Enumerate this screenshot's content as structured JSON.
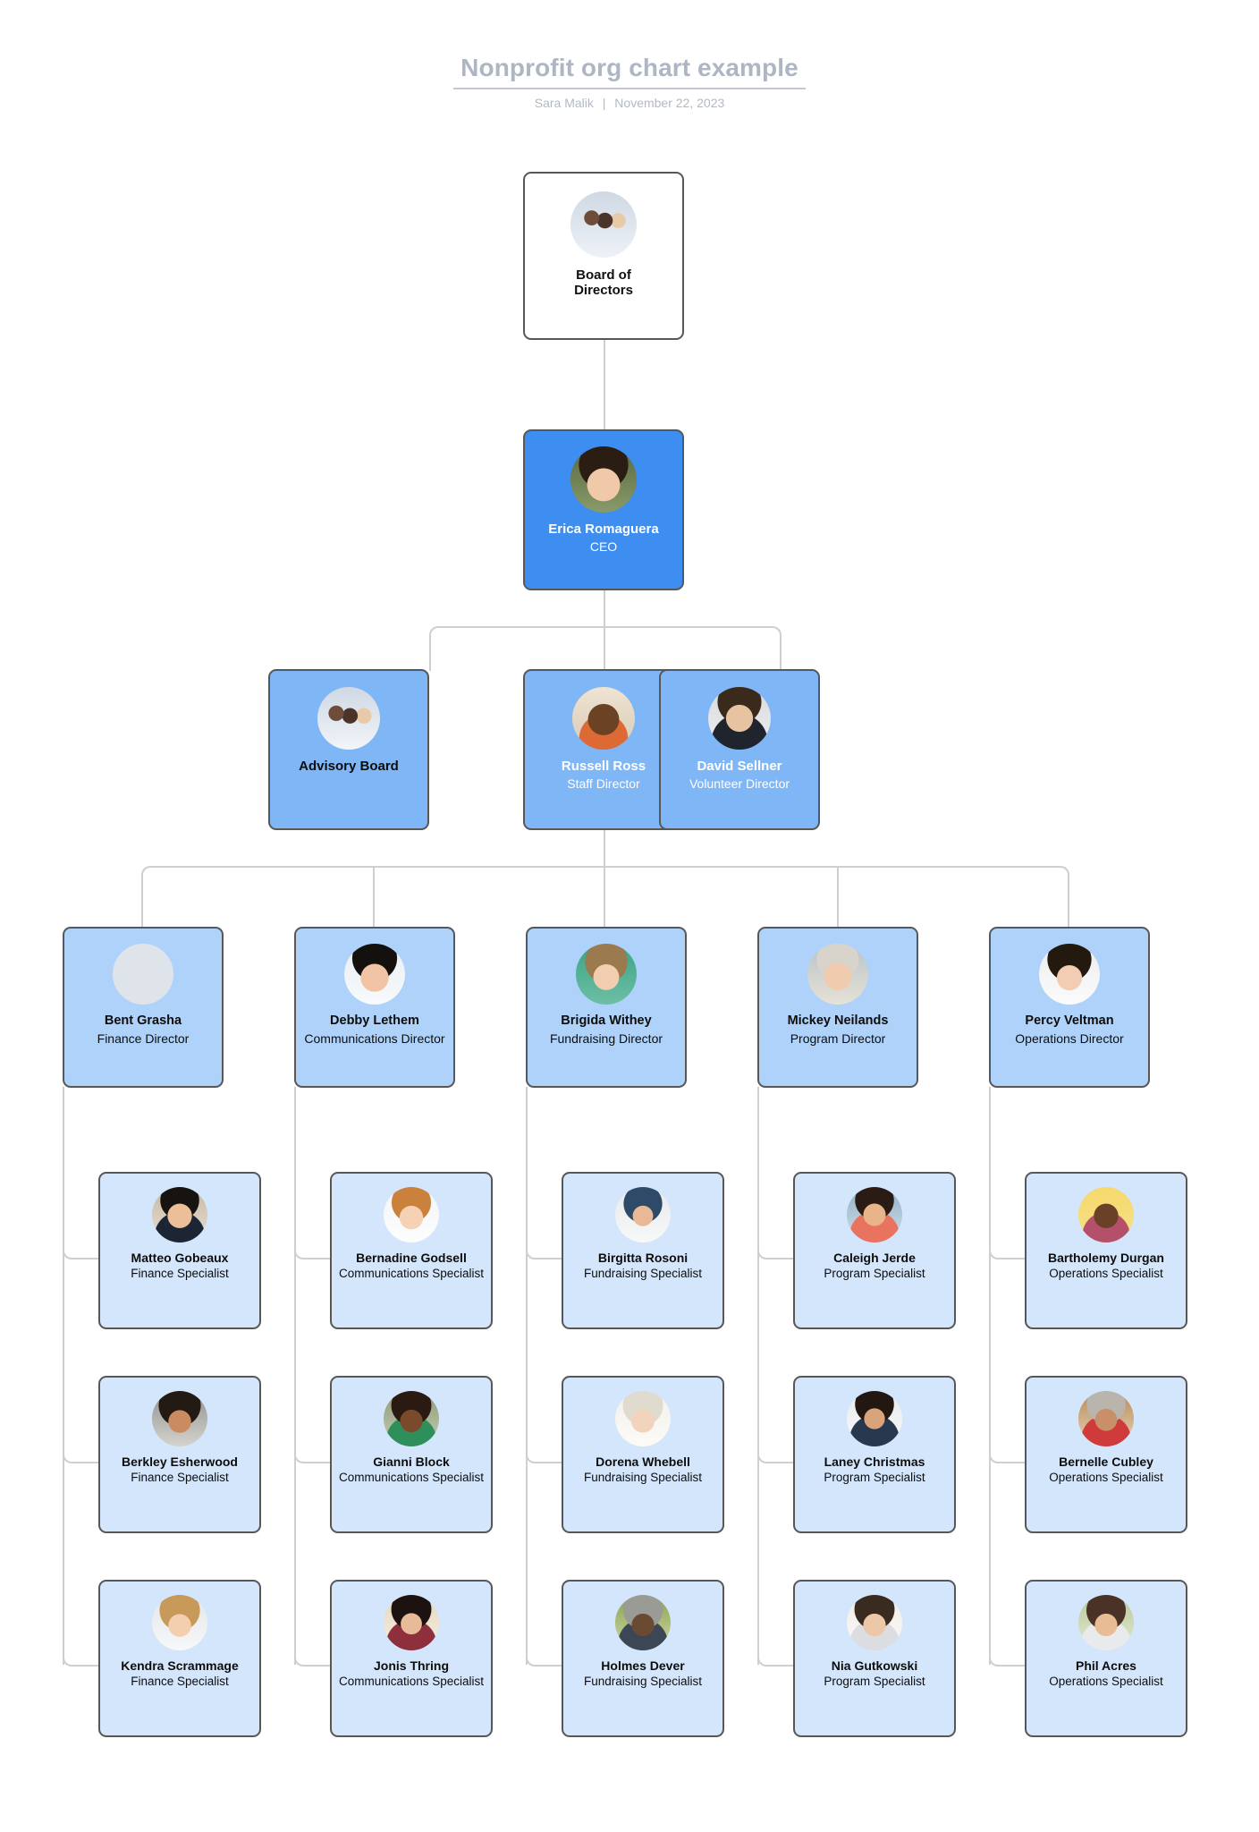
{
  "header": {
    "title": "Nonprofit org chart example",
    "author": "Sara Malik",
    "separator": "|",
    "date": "November 22, 2023"
  },
  "colors": {
    "ceo_fill": "#3d8ef0",
    "tier2_fill": "#7fb6f5",
    "tier3_fill": "#aed2f9",
    "specialist_fill": "#d4e6fc",
    "root_fill": "#ffffff",
    "card_border": "#575757",
    "connector": "#cfcfcf",
    "title_text": "#aeb6c4",
    "subtitle_text": "#b2b9c5"
  },
  "chart_data": {
    "type": "diagram",
    "title": "Nonprofit org chart example",
    "orientation": "top-down",
    "levels": 5,
    "node_count": 25
  },
  "nodes": {
    "board": {
      "name": "Board of Directors",
      "name_line1": "Board of",
      "name_line2": "Directors",
      "title": "",
      "avatar": "group-photo-avatar"
    },
    "ceo": {
      "name": "Erica Romaguera",
      "title": "CEO",
      "avatar": "person-avatar"
    },
    "advisory": {
      "name": "Advisory Board",
      "title": "",
      "avatar": "group-photo-avatar"
    },
    "staff_dir": {
      "name": "Russell Ross",
      "title": "Staff Director",
      "avatar": "person-avatar"
    },
    "volunteer_dir": {
      "name": "David Sellner",
      "title": "Volunteer Director",
      "avatar": "person-avatar"
    },
    "finance_dir": {
      "name": "Bent Grasha",
      "title": "Finance Director",
      "avatar": "person-avatar"
    },
    "comms_dir": {
      "name": "Debby Lethem",
      "title": "Communications Director",
      "avatar": "person-avatar"
    },
    "fund_dir": {
      "name": "Brigida Withey",
      "title": "Fundraising Director",
      "avatar": "person-avatar"
    },
    "program_dir": {
      "name": "Mickey Neilands",
      "title": "Program Director",
      "avatar": "person-avatar"
    },
    "ops_dir": {
      "name": "Percy Veltman",
      "title": "Operations Director",
      "avatar": "person-avatar"
    },
    "fin_s1": {
      "name": "Matteo Gobeaux",
      "title": "Finance Specialist",
      "avatar": "person-avatar"
    },
    "fin_s2": {
      "name": "Berkley Esherwood",
      "title": "Finance Specialist",
      "avatar": "person-avatar"
    },
    "fin_s3": {
      "name": "Kendra Scrammage",
      "title": "Finance Specialist",
      "avatar": "person-avatar"
    },
    "com_s1": {
      "name": "Bernadine Godsell",
      "title": "Communications Specialist",
      "avatar": "person-avatar"
    },
    "com_s2": {
      "name": "Gianni Block",
      "title": "Communications Specialist",
      "avatar": "person-avatar"
    },
    "com_s3": {
      "name": "Jonis Thring",
      "title": "Communications Specialist",
      "avatar": "person-avatar"
    },
    "fun_s1": {
      "name": "Birgitta Rosoni",
      "title": "Fundraising Specialist",
      "avatar": "person-avatar"
    },
    "fun_s2": {
      "name": "Dorena Whebell",
      "title": "Fundraising Specialist",
      "avatar": "person-avatar"
    },
    "fun_s3": {
      "name": "Holmes Dever",
      "title": "Fundraising Specialist",
      "avatar": "person-avatar"
    },
    "pro_s1": {
      "name": "Caleigh Jerde",
      "title": "Program Specialist",
      "avatar": "person-avatar"
    },
    "pro_s2": {
      "name": "Laney Christmas",
      "title": "Program Specialist",
      "avatar": "person-avatar"
    },
    "pro_s3": {
      "name": "Nia Gutkowski",
      "title": "Program Specialist",
      "avatar": "person-avatar"
    },
    "ops_s1": {
      "name": "Bartholemy Durgan",
      "title": "Operations Specialist",
      "avatar": "person-avatar"
    },
    "ops_s2": {
      "name": "Bernelle Cubley",
      "title": "Operations Specialist",
      "avatar": "person-avatar"
    },
    "ops_s3": {
      "name": "Phil Acres",
      "title": "Operations Specialist",
      "avatar": "person-avatar"
    }
  }
}
